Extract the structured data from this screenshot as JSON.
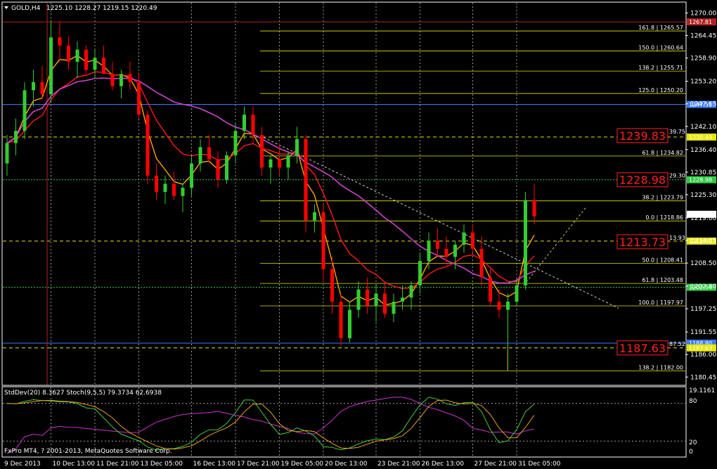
{
  "header": {
    "symbol_label": "GOLD,H4",
    "ohlc": "1225.10 1228.27 1219.15 1220.49"
  },
  "subwindow": {
    "label": "StdDev(20) 8.3627  Stoch(9,5,5) 79.3734 62.6938",
    "scale": {
      "top": "19.1161",
      "upper": "80",
      "lower": "20",
      "zero": "0"
    },
    "copyright": "FxPro MT4, ? 2001-2013, MetaQuotes Software Corp."
  },
  "colors": {
    "bull": "#32cd32",
    "bear": "#ff0000",
    "ma_fast": "#ffa500",
    "ma_slow": "#ff1a1a",
    "ma_long": "#cc44cc",
    "fib": "#e6e600",
    "grid": "#ffffff",
    "axis": "#ffffff",
    "hline_blue": "#3a7bff",
    "hline_red": "#b22222",
    "hline_green": "#2ecc40",
    "stoch_main": "#e6a020",
    "stoch_signal": "#44cc44",
    "stddev": "#cc33cc"
  },
  "chart_data": {
    "type": "candlestick",
    "symbol": "GOLD",
    "timeframe": "H4",
    "price_axis": {
      "ylim": [
        1178.6,
        1272.5
      ],
      "ticks": [
        "1270.00",
        "1264.45",
        "1258.90",
        "1253.20",
        "1247.65",
        "1242.10",
        "1236.40",
        "1230.85",
        "1225.30",
        "1219.60",
        "1214.05",
        "1208.50",
        "1202.80",
        "1197.25",
        "1191.55",
        "1186.00",
        "1180.45"
      ]
    },
    "time_axis": {
      "ticks": [
        "9 Dec 2013",
        "10 Dec 13:00",
        "11 Dec 21:00",
        "13 Dec 05:00",
        "16 Dec 13:00",
        "17 Dec 21:00",
        "19 Dec 05:00",
        "20 Dec 13:00",
        "23 Dec 21:00",
        "26 Dec 13:00",
        "27 Dec 21:00",
        "31 Dec 05:00"
      ]
    },
    "candles": [
      [
        1233,
        1240,
        1230,
        1238
      ],
      [
        1238,
        1244,
        1235,
        1241
      ],
      [
        1241,
        1253,
        1239,
        1251
      ],
      [
        1251,
        1256,
        1247,
        1253
      ],
      [
        1253,
        1257,
        1249,
        1250
      ],
      [
        1250,
        1268,
        1248,
        1264
      ],
      [
        1264,
        1268,
        1258,
        1262
      ],
      [
        1262,
        1264,
        1256,
        1258
      ],
      [
        1258,
        1263,
        1254,
        1261
      ],
      [
        1261,
        1262,
        1255,
        1256
      ],
      [
        1256,
        1261,
        1254,
        1259
      ],
      [
        1259,
        1262,
        1255,
        1255
      ],
      [
        1255,
        1258,
        1251,
        1252
      ],
      [
        1252,
        1256,
        1249,
        1255
      ],
      [
        1255,
        1258,
        1251,
        1253
      ],
      [
        1253,
        1255,
        1244,
        1245
      ],
      [
        1245,
        1246,
        1228,
        1230
      ],
      [
        1230,
        1233,
        1224,
        1226
      ],
      [
        1226,
        1230,
        1223,
        1228
      ],
      [
        1228,
        1231,
        1224,
        1225
      ],
      [
        1225,
        1228,
        1221,
        1227
      ],
      [
        1227,
        1235,
        1225,
        1233
      ],
      [
        1233,
        1239,
        1231,
        1237
      ],
      [
        1237,
        1240,
        1233,
        1234
      ],
      [
        1234,
        1236,
        1227,
        1229
      ],
      [
        1229,
        1236,
        1228,
        1235
      ],
      [
        1235,
        1243,
        1233,
        1241
      ],
      [
        1241,
        1247,
        1239,
        1245
      ],
      [
        1245,
        1247,
        1238,
        1240
      ],
      [
        1240,
        1242,
        1230,
        1232
      ],
      [
        1232,
        1235,
        1228,
        1234
      ],
      [
        1234,
        1238,
        1230,
        1232
      ],
      [
        1232,
        1236,
        1229,
        1235
      ],
      [
        1235,
        1242,
        1233,
        1239
      ],
      [
        1239,
        1240,
        1216,
        1219
      ],
      [
        1219,
        1223,
        1216,
        1221
      ],
      [
        1221,
        1223,
        1204,
        1207
      ],
      [
        1207,
        1210,
        1196,
        1199
      ],
      [
        1199,
        1201,
        1188,
        1190
      ],
      [
        1190,
        1199,
        1189,
        1197
      ],
      [
        1197,
        1204,
        1195,
        1202
      ],
      [
        1202,
        1205,
        1196,
        1198
      ],
      [
        1198,
        1203,
        1194,
        1201
      ],
      [
        1201,
        1204,
        1195,
        1196
      ],
      [
        1196,
        1201,
        1194,
        1199
      ],
      [
        1199,
        1203,
        1197,
        1200
      ],
      [
        1200,
        1204,
        1197,
        1203
      ],
      [
        1203,
        1211,
        1201,
        1209
      ],
      [
        1209,
        1216,
        1207,
        1214
      ],
      [
        1214,
        1217,
        1210,
        1212
      ],
      [
        1212,
        1215,
        1208,
        1210
      ],
      [
        1210,
        1214,
        1207,
        1213
      ],
      [
        1213,
        1218,
        1211,
        1216
      ],
      [
        1216,
        1218,
        1211,
        1212
      ],
      [
        1212,
        1215,
        1203,
        1205
      ],
      [
        1205,
        1207,
        1198,
        1199
      ],
      [
        1199,
        1202,
        1195,
        1197
      ],
      [
        1197,
        1201,
        1182,
        1199
      ],
      [
        1199,
        1205,
        1198,
        1203
      ],
      [
        1203,
        1226,
        1202,
        1224
      ],
      [
        1224,
        1228,
        1218,
        1220
      ]
    ],
    "fibonacci": [
      {
        "level": "161.8",
        "price": 1265.57
      },
      {
        "level": "150.0",
        "price": 1260.64
      },
      {
        "level": "138.2",
        "price": 1255.71
      },
      {
        "level": "125.0",
        "price": 1250.2
      },
      {
        "level": "61.8",
        "price": 1234.82
      },
      {
        "level": "38.2",
        "price": 1223.79
      },
      {
        "level": "0.0",
        "price": 1218.86
      },
      {
        "level": "50.0",
        "price": 1208.41
      },
      {
        "level": "61.8",
        "price": 1203.48
      },
      {
        "level": "100.0",
        "price": 1197.97
      },
      {
        "level": "138.2",
        "price": 1182.0
      }
    ],
    "horizontal_levels": [
      {
        "price": 1267.81,
        "label": "1267.81",
        "color": "#b22222"
      },
      {
        "price": 1247.51,
        "label": "1247.51",
        "color": "#3a7bff"
      },
      {
        "price": 1239.49,
        "label": "1239.49",
        "color": "#e6e600"
      },
      {
        "price": 1228.98,
        "label": "1228.98",
        "color": "#2ecc40"
      },
      {
        "price": 1213.9,
        "label": "1213.90",
        "color": "#e6e600"
      },
      {
        "price": 1202.54,
        "label": "1202.54",
        "color": "#2ecc40"
      },
      {
        "price": 1188.8,
        "label": "1188.80",
        "color": "#3a7bff"
      },
      {
        "price": 1187.63,
        "label": "1187.63",
        "color": "#e6e600"
      }
    ],
    "big_labels": [
      {
        "price": 1239.83,
        "text": "1239.83",
        "side_text": "39.75"
      },
      {
        "price": 1228.98,
        "text": "1228.98",
        "side_text": "29.30"
      },
      {
        "price": 1213.73,
        "text": "1213.73",
        "side_text": "13.93"
      },
      {
        "price": 1187.63,
        "text": "1187.63",
        "side_text": "87.52"
      }
    ],
    "current_price": "1220.49",
    "indicators": {
      "stddev_period": 20,
      "stddev_value": 8.3627,
      "stoch_params": "9,5,5",
      "stoch_main": 79.3734,
      "stoch_signal": 62.6938
    }
  }
}
